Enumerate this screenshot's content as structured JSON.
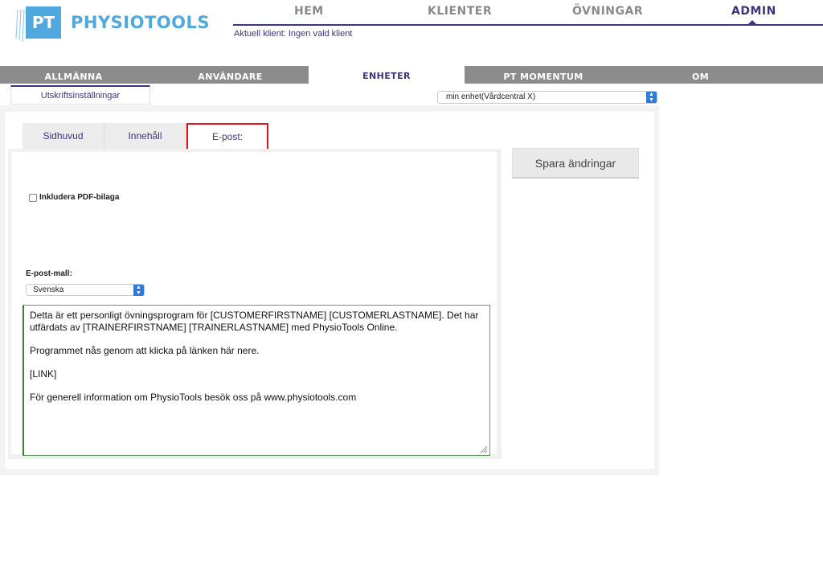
{
  "brand": {
    "logo_mark": "PT",
    "name": "PHYSIOTOOLS",
    "color": "#4fa8de"
  },
  "topnav": {
    "items": [
      "HEM",
      "KLIENTER",
      "ÖVNINGAR",
      "ADMIN"
    ],
    "active": "ADMIN",
    "accent": "#3b3580"
  },
  "client_status": "Aktuell klient: Ingen vald klient",
  "admin_tabs": {
    "items": [
      "ALLMÄNNA",
      "ANVÄNDARE",
      "ENHETER",
      "PT MOMENTUM",
      "OM"
    ],
    "active": "ENHETER"
  },
  "subtab": {
    "label": "Utskriftsinställningar"
  },
  "unit_select": {
    "value": "min enhet(Vårdcentral X)"
  },
  "inner_tabs": {
    "items": [
      "Sidhuvud",
      "Innehåll",
      "E-post:"
    ],
    "active": "E-post:"
  },
  "form": {
    "include_pdf_label": "Inkludera PDF-bilaga",
    "include_pdf_checked": false,
    "template_label": "E-post-mall:",
    "language_value": "Svenska",
    "body": {
      "p1": "Detta är ett personligt övningsprogram för [CUSTOMERFIRSTNAME] [CUSTOMERLASTNAME]. Det har utfärdats av [TRAINERFIRSTNAME] [TRAINERLASTNAME] med PhysioTools Online.",
      "p2": "Programmet nås genom att klicka på länken här nere.",
      "p3": "[LINK]",
      "p4": "För generell information om PhysioTools besök oss på www.physiotools.com"
    }
  },
  "save_button": "Spara ändringar",
  "icons": {
    "select": "select-arrows-icon",
    "resize": "resize-grip-icon",
    "checkbox": "checkbox-icon"
  }
}
